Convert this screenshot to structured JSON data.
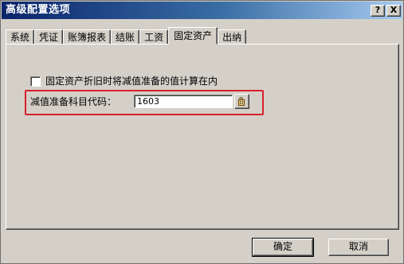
{
  "window": {
    "title": "高级配置选项",
    "help_label": "?",
    "close_label": "X"
  },
  "tabs": [
    {
      "label": "系统"
    },
    {
      "label": "凭证"
    },
    {
      "label": "账簿报表"
    },
    {
      "label": "结账"
    },
    {
      "label": "工资"
    },
    {
      "label": "固定资产",
      "active": true
    },
    {
      "label": "出纳"
    }
  ],
  "fixed_assets": {
    "impairment_checkbox": {
      "label": "固定资产折旧时将减值准备的值计算在内",
      "checked": false
    },
    "account_code": {
      "label": "减值准备科目代码：",
      "value": "1603"
    },
    "lookup_icon": "lookup-icon"
  },
  "footer": {
    "ok_label": "确定",
    "cancel_label": "取消"
  },
  "colors": {
    "titlebar_start": "#0a246a",
    "titlebar_end": "#a6caf0",
    "highlight": "#d8202a",
    "dialog_bg": "#d4d0c8"
  }
}
